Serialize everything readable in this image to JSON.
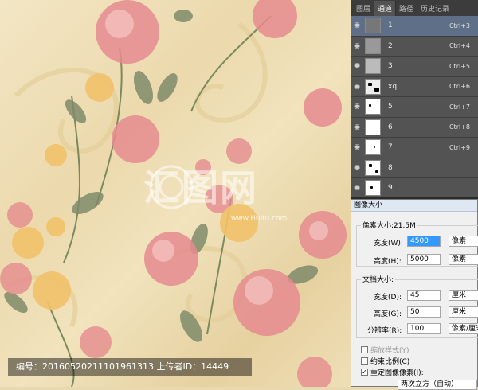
{
  "panel": {
    "tabs": [
      "图层",
      "通道",
      "路径",
      "历史记录"
    ],
    "active_tab": 1,
    "rows": [
      {
        "name": "1",
        "shortcut": "Ctrl+3",
        "selected": true
      },
      {
        "name": "2",
        "shortcut": "Ctrl+4",
        "selected": false
      },
      {
        "name": "3",
        "shortcut": "Ctrl+5",
        "selected": false
      },
      {
        "name": "xq",
        "shortcut": "Ctrl+6",
        "selected": false
      },
      {
        "name": "5",
        "shortcut": "Ctrl+7",
        "selected": false
      },
      {
        "name": "6",
        "shortcut": "Ctrl+8",
        "selected": false
      },
      {
        "name": "7",
        "shortcut": "Ctrl+9",
        "selected": false
      },
      {
        "name": "8",
        "shortcut": "",
        "selected": false
      },
      {
        "name": "9",
        "shortcut": "",
        "selected": false
      }
    ]
  },
  "dialog": {
    "title": "图像大小",
    "pixel_size_label": "像素大小:21.5M",
    "width_label": "宽度(W):",
    "width_value": "4500",
    "width_unit": "像素",
    "height_label": "高度(H):",
    "height_value": "5000",
    "height_unit": "像素",
    "doc_size_label": "文档大小:",
    "doc_width_label": "宽度(D):",
    "doc_width_value": "45",
    "doc_width_unit": "厘米",
    "doc_height_label": "高度(G):",
    "doc_height_value": "50",
    "doc_height_unit": "厘米",
    "resolution_label": "分辨率(R):",
    "resolution_value": "100",
    "resolution_unit": "像素/厘米",
    "scale_styles": "缩放样式(Y)",
    "constrain": "约束比例(C)",
    "resample": "重定图像像素(I):",
    "resample_method": "两次立方（自动）"
  },
  "caption": "编号：20160520211101961313 上传者ID：14449",
  "watermark": "汇图网",
  "watermark_url": "www.Huitu.com"
}
